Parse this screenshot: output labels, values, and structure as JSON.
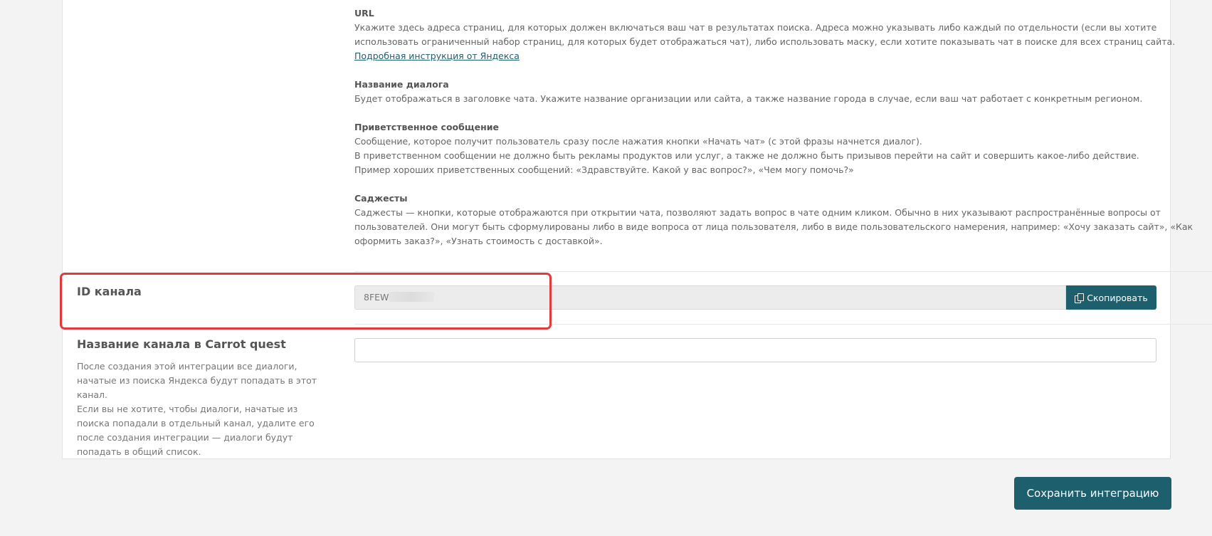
{
  "help": {
    "url": {
      "title": "URL",
      "text": "Укажите здесь адреса страниц, для которых должен включаться ваш чат в результатах поиска. Адреса можно указывать либо каждый по отдельности (если вы хотите использовать ограниченный набор страниц, для которых будет отображаться чат), либо использовать маску, если хотите показывать чат в поиске для всех страниц сайта.",
      "link": "Подробная инструкция от Яндекса"
    },
    "dialog_name": {
      "title": "Название диалога",
      "text": "Будет отображаться в заголовке чата. Укажите название организации или сайта, а также название города в случае, если ваш чат работает с конкретным регионом."
    },
    "greeting": {
      "title": "Приветственное сообщение",
      "line1": "Сообщение, которое получит пользователь сразу после нажатия кнопки «Начать чат» (с этой фразы начнется диалог).",
      "line2": "В приветственном сообщении не должно быть рекламы продуктов или услуг, а также не должно быть призывов перейти на сайт и совершить какое-либо действие.",
      "line3": "Пример хороших приветственных сообщений: «Здравствуйте. Какой у вас вопрос?», «Чем могу помочь?»"
    },
    "suggests": {
      "title": "Саджесты",
      "text": "Саджесты — кнопки, которые отображаются при открытии чата, позволяют задать вопрос в чате одним кликом. Обычно в них указывают распространённые вопросы от пользователей. Они могут быть сформулированы либо в виде вопроса от лица пользователя, либо в виде пользовательского намерения, например: «Хочу заказать сайт», «Как оформить заказ?», «Узнать стоимость с доставкой»."
    }
  },
  "channel_id": {
    "label": "ID канала",
    "value": "8FEW",
    "copy_label": "Скопировать"
  },
  "channel_name": {
    "label": "Название канала в Carrot quest",
    "description_1": "После создания этой интеграции все диалоги, начатые из поиска Яндекса будут попадать в этот канал.",
    "description_2": "Если вы не хотите, чтобы диалоги, начатые из поиска попадали в отдельный канал, удалите его после создания интеграции — диалоги будут попадать в общий список.",
    "value": "",
    "placeholder": ""
  },
  "save_label": "Сохранить интеграцию",
  "colors": {
    "accent": "#1e5f6e",
    "highlight": "#e03a3a",
    "background": "#f3f3f3"
  },
  "icons": {
    "copy": "copy-icon"
  }
}
